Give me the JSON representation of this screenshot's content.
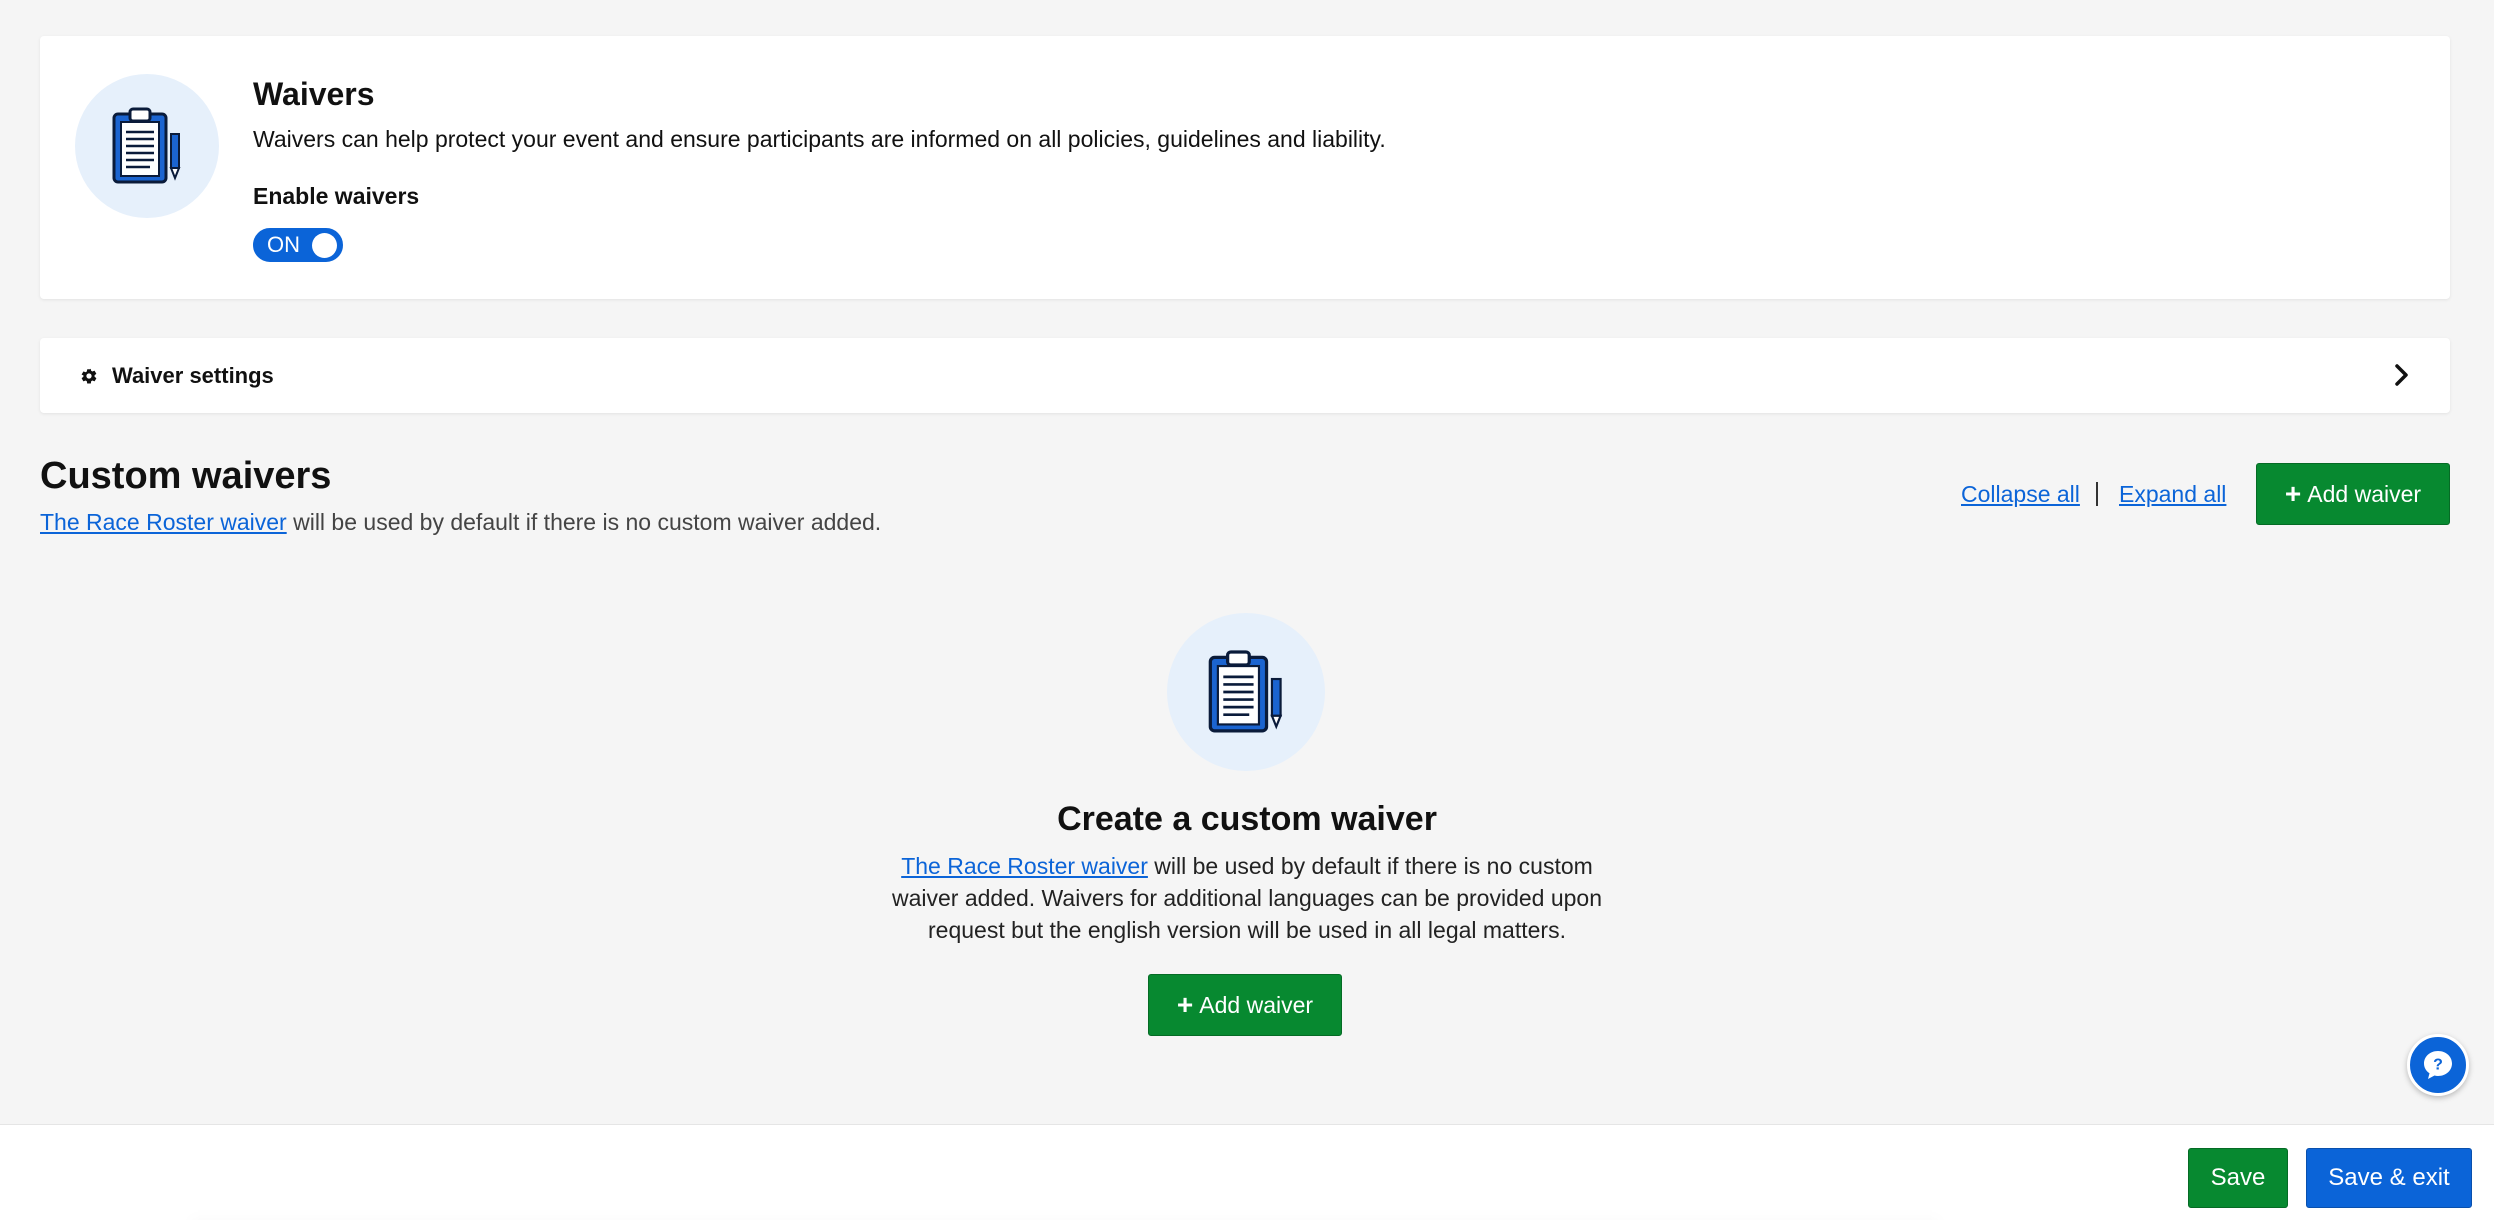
{
  "waivers_card": {
    "title": "Waivers",
    "description": "Waivers can help protect your event and ensure participants are informed on all policies, guidelines and liability.",
    "enable_label": "Enable waivers",
    "toggle_label": "ON",
    "icon": "clipboard-icon"
  },
  "settings_bar": {
    "label": "Waiver settings",
    "icon": "gear-icon",
    "chevron": "chevron-right-icon"
  },
  "custom_waivers": {
    "title": "Custom waivers",
    "link_text": "The Race Roster waiver",
    "description_rest": " will be used by default if there is no custom waiver added.",
    "collapse_all": "Collapse all",
    "expand_all": "Expand all",
    "add_button": "Add waiver"
  },
  "empty_state": {
    "icon": "clipboard-icon",
    "title": "Create a custom waiver",
    "link_text": "The Race Roster waiver",
    "description_rest": " will be used by default if there is no custom waiver added. Waivers for additional languages can be provided upon request but the english version will be used in all legal matters.",
    "add_button": "Add waiver"
  },
  "footer": {
    "save": "Save",
    "save_exit": "Save & exit"
  },
  "help": {
    "icon": "help-icon"
  },
  "colors": {
    "primary_blue": "#0b64d8",
    "green": "#078930",
    "icon_bg": "#e6f0fb"
  }
}
